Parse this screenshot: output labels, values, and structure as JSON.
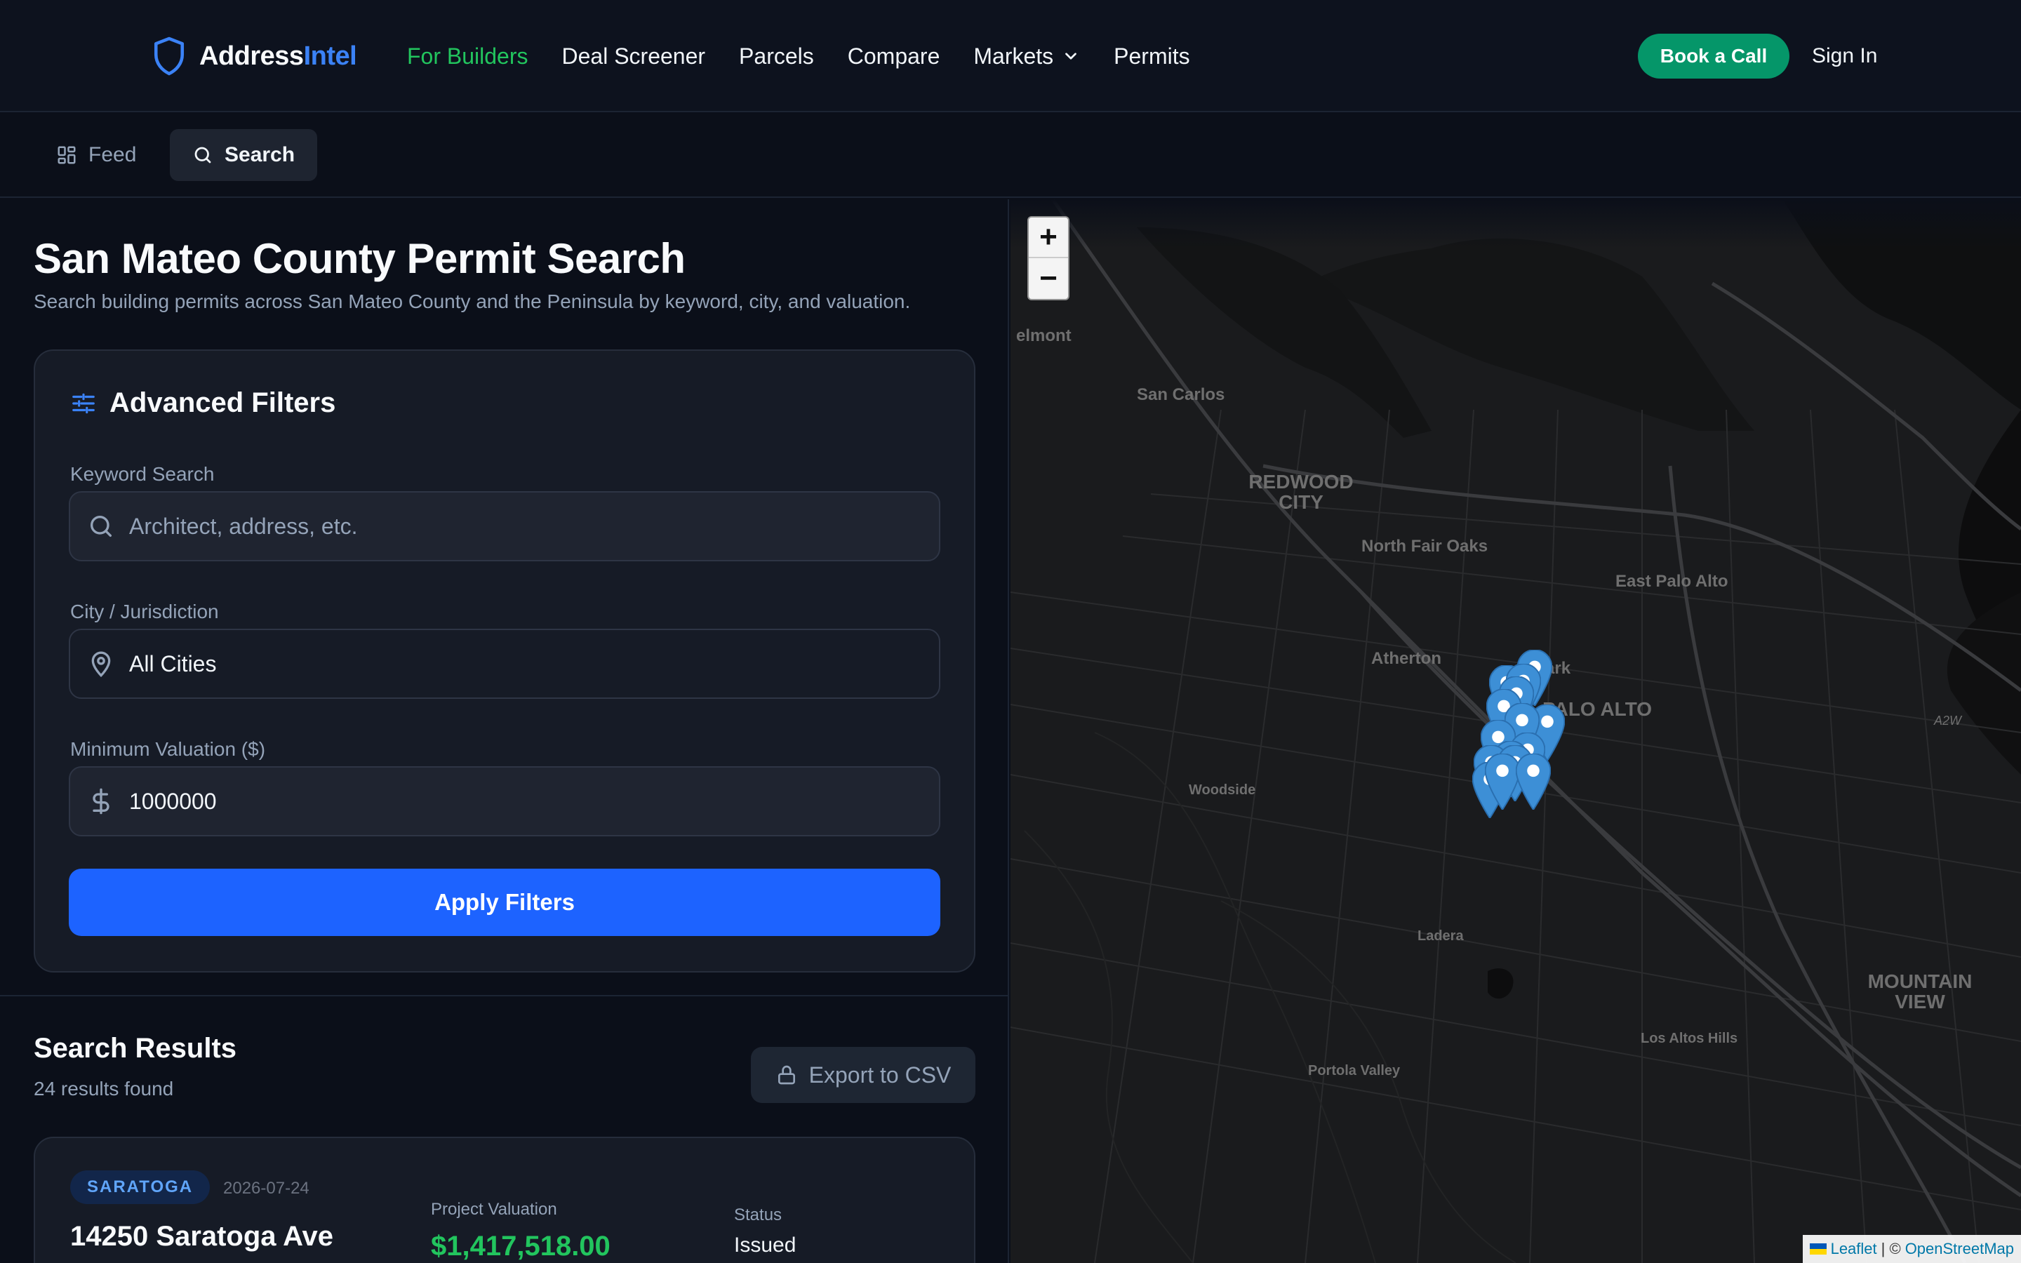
{
  "brand": {
    "part1": "Address",
    "part2": "Intel"
  },
  "nav": {
    "links": [
      "For Builders",
      "Deal Screener",
      "Parcels",
      "Compare",
      "Markets",
      "Permits"
    ],
    "cta": "Book a Call",
    "signin": "Sign In"
  },
  "subnav": {
    "feed": "Feed",
    "search": "Search"
  },
  "page": {
    "title": "San Mateo County Permit Search",
    "subtitle": "Search building permits across San Mateo County and the Peninsula by keyword, city, and valuation."
  },
  "filters": {
    "title": "Advanced Filters",
    "keyword_label": "Keyword Search",
    "keyword_placeholder": "Architect, address, etc.",
    "city_label": "City / Jurisdiction",
    "city_value": "All Cities",
    "valuation_label": "Minimum Valuation ($)",
    "valuation_value": "1000000",
    "apply": "Apply Filters"
  },
  "results": {
    "title": "Search Results",
    "count": "24 results found",
    "export": "Export to CSV",
    "cards": [
      {
        "city": "SARATOGA",
        "date": "2026-07-24",
        "address": "14250 Saratoga Ave",
        "valuation_label": "Project Valuation",
        "valuation": "$1,417,518.00",
        "status_label": "Status",
        "status": "Issued"
      }
    ]
  },
  "map": {
    "zoom_in": "+",
    "zoom_out": "−",
    "labels": {
      "belmont": "elmont",
      "san_carlos": "San Carlos",
      "redwood_city": "REDWOOD CITY",
      "north_fair_oaks": "North Fair Oaks",
      "east_palo_alto": "East Palo Alto",
      "atherton": "Atherton",
      "park": "Park",
      "palo_alto": "PALO ALTO",
      "woodside": "Woodside",
      "ladera": "Ladera",
      "portola_valley": "Portola Valley",
      "los_altos_hills": "Los Altos Hills",
      "mountain_view": "MOUNTAIN VIEW",
      "a2w": "A2W"
    },
    "attribution": {
      "leaflet": "Leaflet",
      "sep": "| ©",
      "osm": "OpenStreetMap"
    },
    "marker_color": "#3d8fd6"
  },
  "colors": {
    "accent_blue": "#3b82f6",
    "accent_green": "#22c55e",
    "cta_green": "#059669",
    "apply_blue": "#1d63ff"
  }
}
